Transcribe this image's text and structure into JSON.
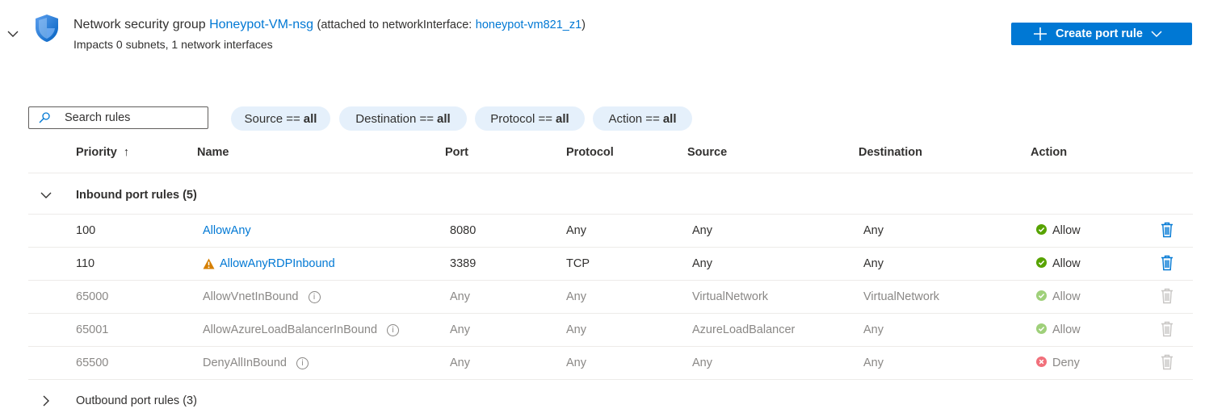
{
  "header": {
    "title_prefix": "Network security group",
    "nsg_name": "Honeypot-VM-nsg",
    "attached_prefix": "(attached to networkInterface:",
    "interface_name": "honeypot-vm821_z1",
    "attached_suffix": ")",
    "subtitle": "Impacts 0 subnets, 1 network interfaces",
    "create_button": "Create port rule"
  },
  "filters": {
    "search_placeholder": "Search rules",
    "pills": [
      {
        "label": "Source ==",
        "value": "all"
      },
      {
        "label": "Destination ==",
        "value": "all"
      },
      {
        "label": "Protocol ==",
        "value": "all"
      },
      {
        "label": "Action ==",
        "value": "all"
      }
    ]
  },
  "columns": {
    "priority": "Priority",
    "sort_indicator": "↑",
    "name": "Name",
    "port": "Port",
    "protocol": "Protocol",
    "source": "Source",
    "destination": "Destination",
    "action": "Action"
  },
  "inbound": {
    "label": "Inbound port rules (5)",
    "rows": [
      {
        "priority": "100",
        "name": "AllowAny",
        "port": "8080",
        "protocol": "Any",
        "source": "Any",
        "destination": "Any",
        "action": "Allow"
      },
      {
        "priority": "110",
        "name": "AllowAnyRDPInbound",
        "port": "3389",
        "protocol": "TCP",
        "source": "Any",
        "destination": "Any",
        "action": "Allow"
      },
      {
        "priority": "65000",
        "name": "AllowVnetInBound",
        "port": "Any",
        "protocol": "Any",
        "source": "VirtualNetwork",
        "destination": "VirtualNetwork",
        "action": "Allow"
      },
      {
        "priority": "65001",
        "name": "AllowAzureLoadBalancerInBound",
        "port": "Any",
        "protocol": "Any",
        "source": "AzureLoadBalancer",
        "destination": "Any",
        "action": "Allow"
      },
      {
        "priority": "65500",
        "name": "DenyAllInBound",
        "port": "Any",
        "protocol": "Any",
        "source": "Any",
        "destination": "Any",
        "action": "Deny"
      }
    ]
  },
  "outbound": {
    "label": "Outbound port rules (3)"
  },
  "info_glyph": "i",
  "colors": {
    "accent": "#0078d4",
    "allow": "#57a300",
    "allow_dim": "#9fd07a",
    "deny_dim": "#f1707b",
    "warning": "#d67f00",
    "pill_bg": "#e5f0fb"
  }
}
